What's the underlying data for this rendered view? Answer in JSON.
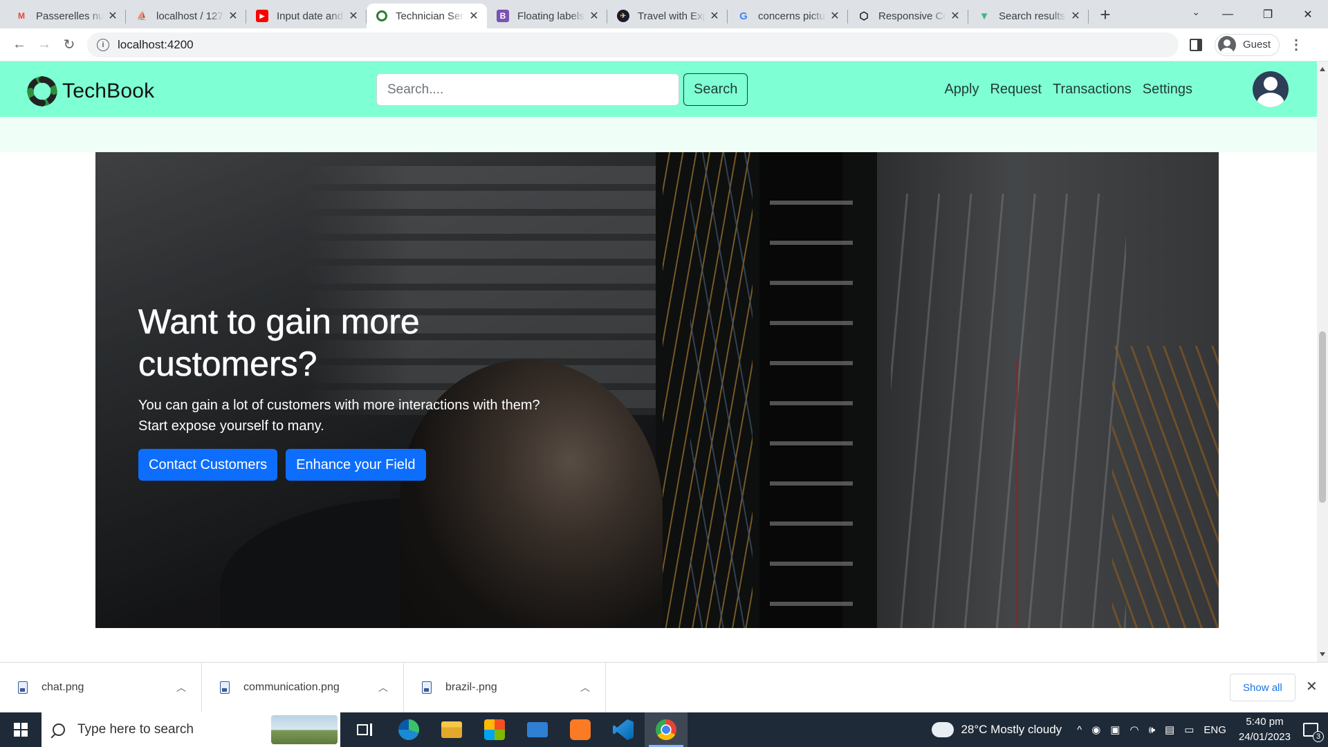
{
  "browser": {
    "tabs": [
      {
        "title": "Passerelles nu",
        "favicon": "gmail-icon",
        "color": "#ea4335"
      },
      {
        "title": "localhost / 127",
        "favicon": "phpmyadmin-icon",
        "color": "#f29111"
      },
      {
        "title": "Input date and",
        "favicon": "youtube-icon",
        "color": "#ff0000"
      },
      {
        "title": "Technician Ser",
        "favicon": "techbook-icon",
        "color": "#2e7d32",
        "active": true
      },
      {
        "title": "Floating labels",
        "favicon": "bootstrap-icon",
        "color": "#7952b3"
      },
      {
        "title": "Travel with Exp",
        "favicon": "expedia-icon",
        "color": "#1a1a2e"
      },
      {
        "title": "concerns pictu",
        "favicon": "google-icon",
        "color": "#4285f4"
      },
      {
        "title": "Responsive Co",
        "favicon": "codepen-icon",
        "color": "#111111"
      },
      {
        "title": "Search results",
        "favicon": "vue-icon",
        "color": "#41b883"
      }
    ],
    "address": "localhost:4200",
    "profile_label": "Guest"
  },
  "site": {
    "brand": "TechBook",
    "search_placeholder": "Search....",
    "search_button": "Search",
    "nav": [
      "Apply",
      "Request",
      "Transactions",
      "Settings"
    ],
    "accent": "#7fffd4"
  },
  "hero": {
    "title": "Want to gain more customers?",
    "subtitle_line1": "You can gain a lot of customers with more interactions with them?",
    "subtitle_line2": "Start expose yourself to many.",
    "btn_primary": "Contact Customers",
    "btn_secondary": "Enhance your Field",
    "button_color": "#0d6efd"
  },
  "downloads": {
    "items": [
      "chat.png",
      "communication.png",
      "brazil-.png"
    ],
    "show_all": "Show all"
  },
  "taskbar": {
    "search_placeholder": "Type here to search",
    "weather": "28°C  Mostly cloudy",
    "language": "ENG",
    "time": "5:40 pm",
    "date": "24/01/2023",
    "notification_count": "3"
  }
}
